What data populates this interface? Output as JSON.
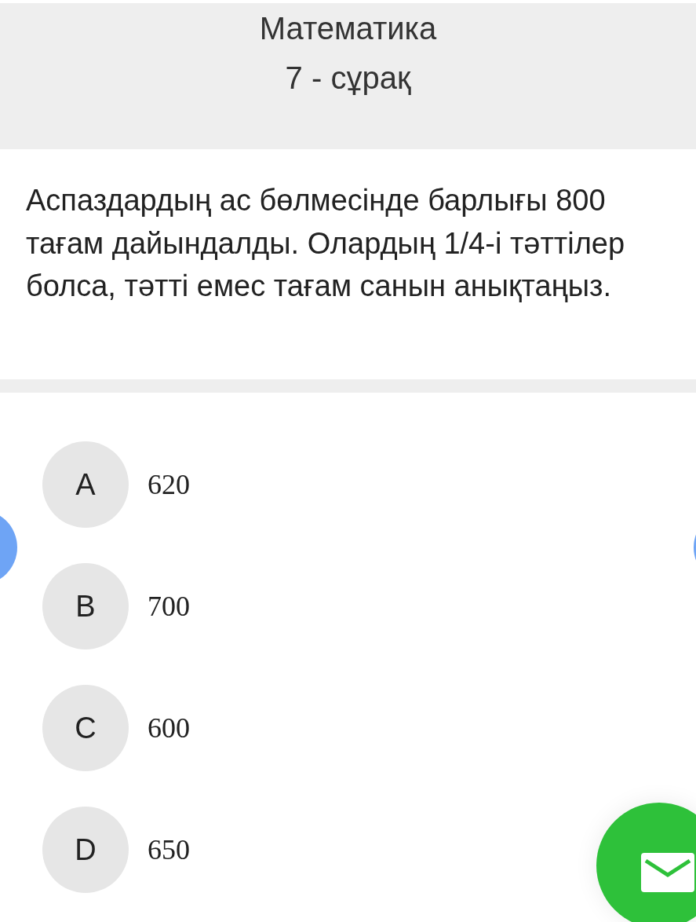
{
  "header": {
    "subject": "Математика",
    "question_number": "7 - сұрақ"
  },
  "question": "Аспаздардың ас бөлмесінде барлығы 800 тағам дайындалды. Олардың 1/4-і тәттілер болса, тәтті емес тағам санын анықтаңыз.",
  "options": [
    {
      "letter": "A",
      "answer": "620"
    },
    {
      "letter": "B",
      "answer": "700"
    },
    {
      "letter": "C",
      "answer": "600"
    },
    {
      "letter": "D",
      "answer": "650"
    }
  ]
}
